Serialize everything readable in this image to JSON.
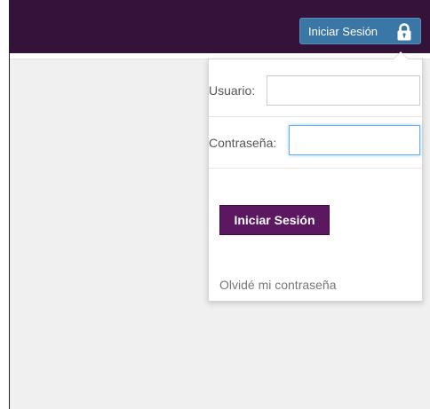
{
  "header": {
    "login_toggle_label": "Iniciar Sesión",
    "login_toggle_icon": "lock-icon"
  },
  "login_form": {
    "username_label": "Usuario:",
    "username_value": "",
    "password_label": "Contraseña:",
    "password_value": "",
    "submit_label": "Iniciar Sesión",
    "forgot_password_label": "Olvidé mi contraseña"
  },
  "colors": {
    "topbar": "#34133b",
    "toggle_button": "#3a76a6",
    "submit_button": "#5b1760",
    "focus_border": "#66afe9"
  }
}
